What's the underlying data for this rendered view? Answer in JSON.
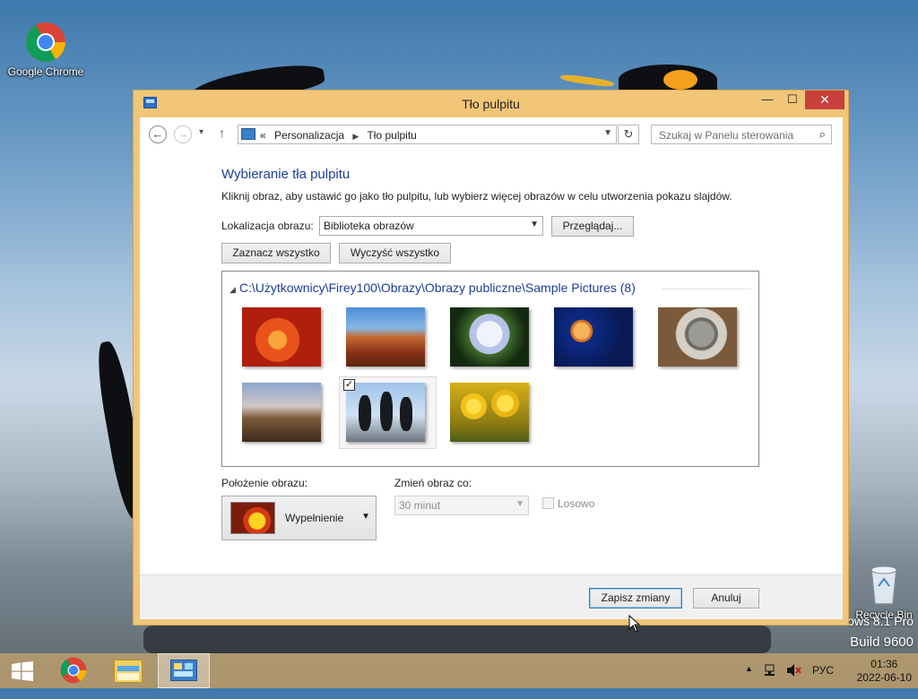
{
  "desktop": {
    "icons": [
      {
        "label": "Google Chrome"
      },
      {
        "label": "Recycle Bin"
      }
    ],
    "watermark": {
      "line1": "ows 8.1 Pro",
      "line2": "Build 9600"
    }
  },
  "window": {
    "title": "Tło pulpitu",
    "controls": {
      "minimize": "—",
      "maximize": "☐",
      "close": "✕"
    },
    "nav": {
      "back": "←",
      "forward": "→",
      "recent": "▾",
      "up": "↑",
      "breadcrumb_prefix": "«",
      "breadcrumbs": [
        "Personalizacja",
        "Tło pulpitu"
      ],
      "refresh": "↻",
      "search_placeholder": "Szukaj w Panelu sterowania"
    },
    "heading": "Wybieranie tła pulpitu",
    "description": "Kliknij obraz, aby ustawić go jako tło pulpitu, lub wybierz więcej obrazów w celu utworzenia pokazu slajdów.",
    "location": {
      "label": "Lokalizacja obrazu:",
      "value": "Biblioteka obrazów",
      "browse_label": "Przeglądaj..."
    },
    "select_all_label": "Zaznacz wszystko",
    "clear_all_label": "Wyczyść wszystko",
    "gallery": {
      "group_title": "C:\\Użytkownicy\\Firey100\\Obrazy\\Obrazy publiczne\\Sample Pictures (8)",
      "pictures": [
        {
          "name": "flower-red",
          "selected": false,
          "colors": [
            "#f3772a",
            "#c81d0d"
          ]
        },
        {
          "name": "desert",
          "selected": false,
          "colors": [
            "#5d91cf",
            "#b5532a"
          ]
        },
        {
          "name": "hydrangeas",
          "selected": false,
          "colors": [
            "#d9e0f5",
            "#2f5a24"
          ]
        },
        {
          "name": "jellyfish",
          "selected": false,
          "colors": [
            "#0b2b7f",
            "#f29a3c"
          ]
        },
        {
          "name": "koala",
          "selected": false,
          "colors": [
            "#b3aea6",
            "#6b4a2f"
          ]
        },
        {
          "name": "lighthouse",
          "selected": false,
          "colors": [
            "#8aa0c4",
            "#6c4a2b"
          ]
        },
        {
          "name": "penguins",
          "selected": true,
          "colors": [
            "#a8c6e8",
            "#1a1d22"
          ]
        },
        {
          "name": "tulips",
          "selected": false,
          "colors": [
            "#f1d02d",
            "#c98d0b"
          ]
        }
      ]
    },
    "position": {
      "label": "Położenie obrazu:",
      "value": "Wypełnienie"
    },
    "change": {
      "label": "Zmień obraz co:",
      "value": "30 minut"
    },
    "shuffle_label": "Losowo",
    "save_label": "Zapisz zmiany",
    "cancel_label": "Anuluj"
  },
  "taskbar": {
    "language": "РУС",
    "time": "01:36",
    "date": "2022-06-10",
    "show_hidden": "▲"
  }
}
